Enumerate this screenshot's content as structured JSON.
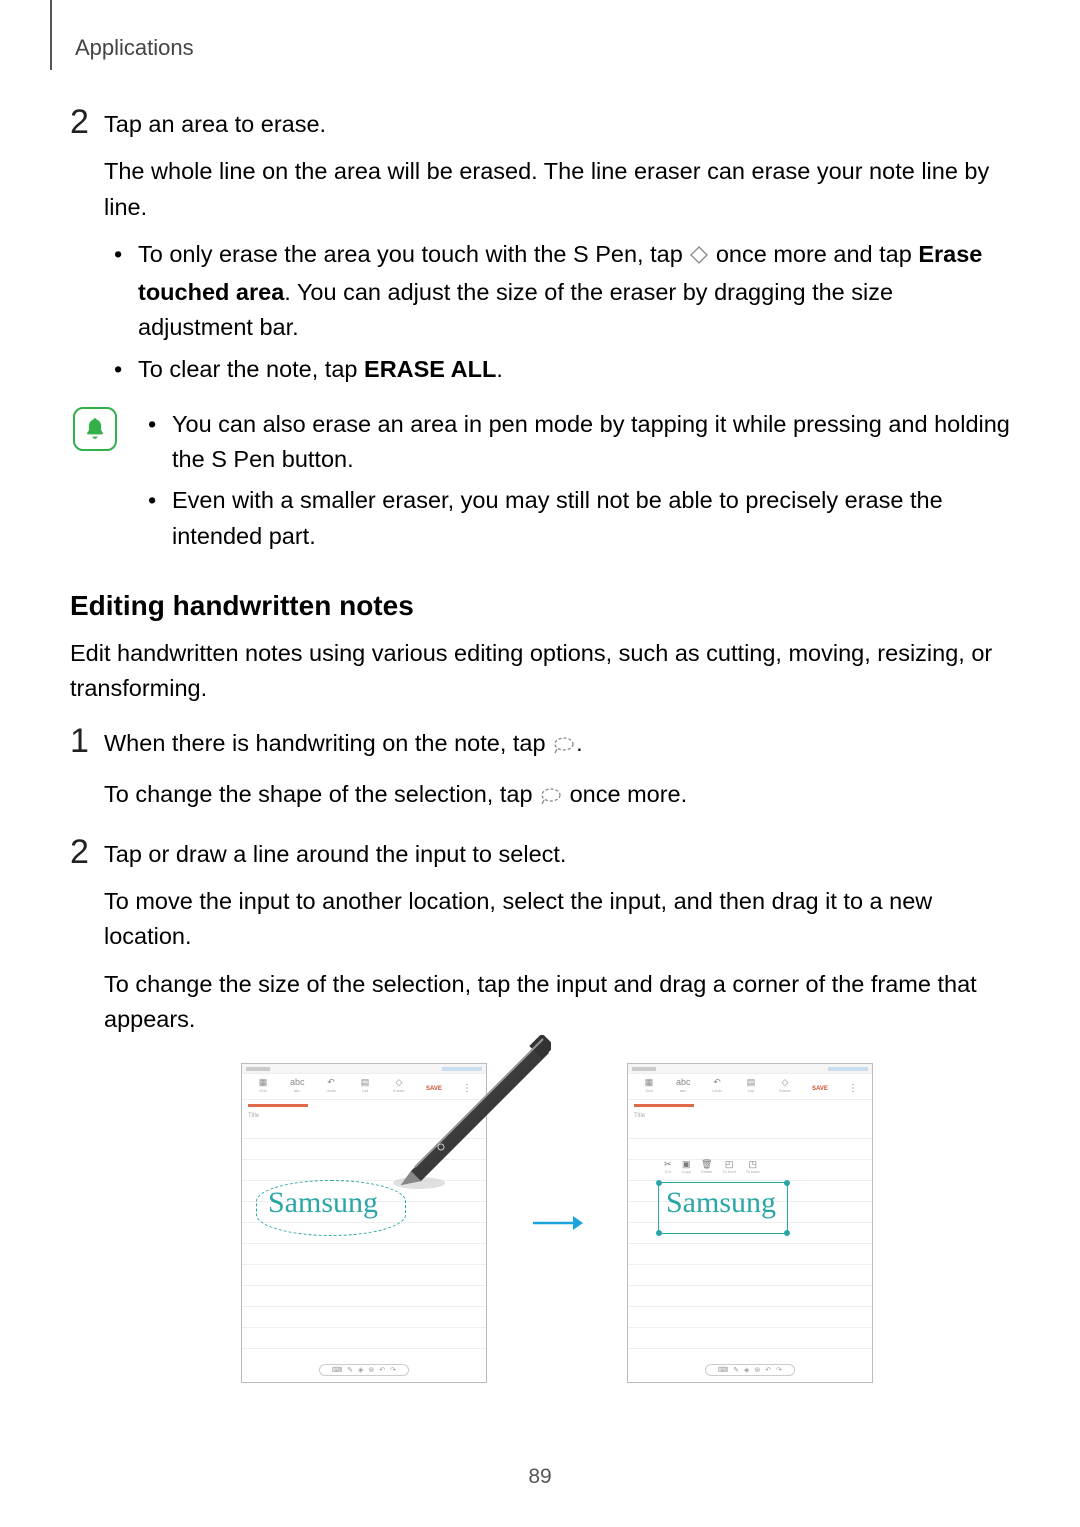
{
  "header": "Applications",
  "step2a": {
    "num": "2",
    "line1": "Tap an area to erase.",
    "line2": "The whole line on the area will be erased. The line eraser can erase your note line by line.",
    "bullet1_a": "To only erase the area you touch with the S Pen, tap ",
    "bullet1_b": " once more and tap ",
    "bullet1_bold": "Erase touched area",
    "bullet1_c": ". You can adjust the size of the eraser by dragging the size adjustment bar.",
    "bullet2_a": "To clear the note, tap ",
    "bullet2_bold": "ERASE ALL",
    "bullet2_b": "."
  },
  "note": {
    "bullet1": "You can also erase an area in pen mode by tapping it while pressing and holding the S Pen button.",
    "bullet2": "Even with a smaller eraser, you may still not be able to precisely erase the intended part."
  },
  "heading": "Editing handwritten notes",
  "intro": "Edit handwritten notes using various editing options, such as cutting, moving, resizing, or transforming.",
  "step1": {
    "num": "1",
    "line1_a": "When there is handwriting on the note, tap ",
    "line1_b": ".",
    "line2_a": "To change the shape of the selection, tap ",
    "line2_b": " once more."
  },
  "step2b": {
    "num": "2",
    "line1": "Tap or draw a line around the input to select.",
    "line2": "To move the input to another location, select the input, and then drag it to a new location.",
    "line3": "To change the size of the selection, tap the input and drag a corner of the frame that appears."
  },
  "figure": {
    "handwriting": "Samsung",
    "toolbar_labels": [
      "Grid",
      "abc",
      "Undo",
      "List",
      "Eraser"
    ],
    "save": "SAVE",
    "title": "Title",
    "edit_labels": [
      "Cut",
      "Copy",
      "Delete",
      "To front",
      "To back"
    ]
  },
  "page_number": "89"
}
